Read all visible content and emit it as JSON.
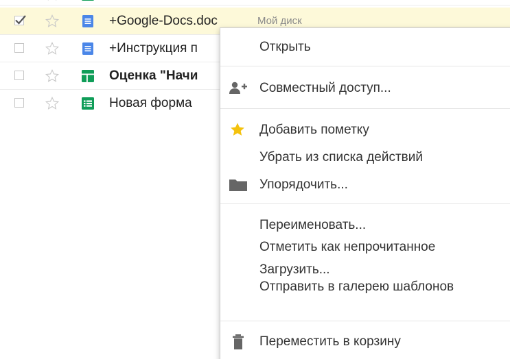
{
  "file_list": {
    "rows": [
      {
        "name": "+Google-Docs.doc",
        "owner": "Мой диск",
        "type_icon": "docs-icon",
        "starred": false,
        "checked": true,
        "bold": false
      },
      {
        "name": "+Инструкция п",
        "type_icon": "docs-icon",
        "starred": false,
        "checked": false,
        "bold": false
      },
      {
        "name": "Оценка \"Начи",
        "type_icon": "sheets-icon",
        "starred": false,
        "checked": false,
        "bold": true
      },
      {
        "name": "Новая форма",
        "type_icon": "forms-icon",
        "starred": false,
        "checked": false,
        "bold": false
      }
    ]
  },
  "context_menu": {
    "items": [
      {
        "label": "Открыть"
      },
      {
        "label": "Совместный доступ...",
        "icon": "add-person-icon"
      },
      {
        "label": "Добавить пометку",
        "icon": "star-icon"
      },
      {
        "label": "Убрать из списка действий"
      },
      {
        "label": "Упорядочить...",
        "icon": "folder-icon"
      },
      {
        "label": "Переименовать..."
      },
      {
        "label": "Отметить как непрочитанное"
      },
      {
        "label": "Загрузить..."
      },
      {
        "label": "Отправить в галерею шаблонов"
      },
      {
        "label": "Переместить в корзину",
        "icon": "trash-icon"
      }
    ]
  },
  "colors": {
    "selected_row": "#fdf9d9",
    "docs_blue": "#4a86e8",
    "sheets_green": "#0f9d58",
    "star_yellow": "#f4c20d",
    "menu_text": "#333333"
  }
}
